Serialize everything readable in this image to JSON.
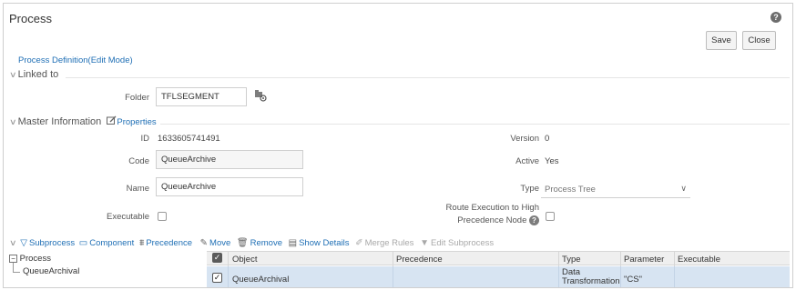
{
  "window": {
    "title": "Process"
  },
  "header": {
    "save_label": "Save",
    "close_label": "Close"
  },
  "mode_label": "Process Definition(Edit Mode)",
  "linked": {
    "section_label": "Linked to",
    "folder_label": "Folder",
    "folder_value": "TFLSEGMENT"
  },
  "master": {
    "section_label": "Master Information",
    "properties_label": "Properties",
    "id_label": "ID",
    "id_value": "1633605741491",
    "version_label": "Version",
    "version_value": "0",
    "code_label": "Code",
    "code_value": "QueueArchive",
    "active_label": "Active",
    "active_value": "Yes",
    "name_label": "Name",
    "name_value": "QueueArchive",
    "type_label": "Type",
    "type_value": "Process Tree",
    "executable_label": "Executable",
    "route_label_line1": "Route Execution to High",
    "route_label_line2": "Precedence Node"
  },
  "toolbar": {
    "subprocess": "Subprocess",
    "component": "Component",
    "precedence": "Precedence",
    "move": "Move",
    "remove": "Remove",
    "show_details": "Show Details",
    "merge_rules": "Merge Rules",
    "edit_subprocess": "Edit Subprocess"
  },
  "tree": {
    "root": "Process",
    "child": "QueueArchival"
  },
  "grid": {
    "columns": [
      "Object",
      "Precedence",
      "Type",
      "Parameter",
      "Executable"
    ],
    "rows": [
      {
        "object": "QueueArchival",
        "precedence": "",
        "type_line1": "Data",
        "type_line2": "Transformation",
        "parameter": "\"CS\"",
        "executable": ""
      }
    ]
  },
  "colors": {
    "link": "#1f6fb5",
    "selected_row": "#d7e4f2"
  }
}
